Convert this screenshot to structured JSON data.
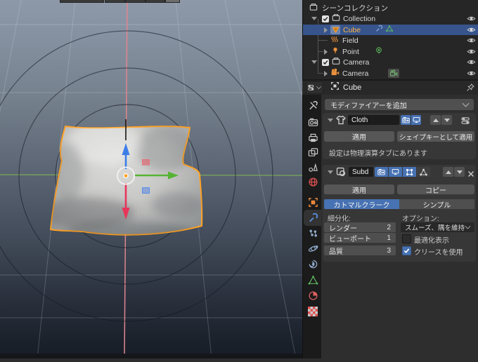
{
  "outliner": {
    "scene_collection": "シーンコレクション",
    "collection": "Collection",
    "cube": "Cube",
    "field": "Field",
    "point": "Point",
    "camera_collection": "Camera",
    "camera": "Camera"
  },
  "properties": {
    "breadcrumb_object": "Cube",
    "add_modifier": "モディファイアーを追加",
    "cloth": {
      "name": "Cloth",
      "apply": "適用",
      "apply_as_shapekey": "シェイプキーとして適用",
      "info": "設定は物理演算タブにあります"
    },
    "subdiv": {
      "name": "Subd",
      "apply": "適用",
      "copy": "コピー",
      "catmull_clark": "カトマルクラーク",
      "simple": "シンプル",
      "subdivision_label": "細分化:",
      "options_label": "オプション:",
      "render_label": "レンダー",
      "render_value": "2",
      "viewport_label": "ビューポート",
      "viewport_value": "1",
      "quality_label": "品質",
      "quality_value": "3",
      "uv_smooth": "スムーズ、隅を維持",
      "optimal_display": "最適化表示",
      "use_creases": "クリースを使用"
    }
  },
  "colors": {
    "accent_blue": "#4772b3",
    "selection_blue": "#37558c",
    "active_object_orange": "#ffa226",
    "gizmo_z_blue": "#3d7de8",
    "gizmo_y_green": "#56b334",
    "gizmo_x_red": "#e8365a",
    "axis_pink": "#e0858f",
    "axis_green": "#79a85a"
  }
}
